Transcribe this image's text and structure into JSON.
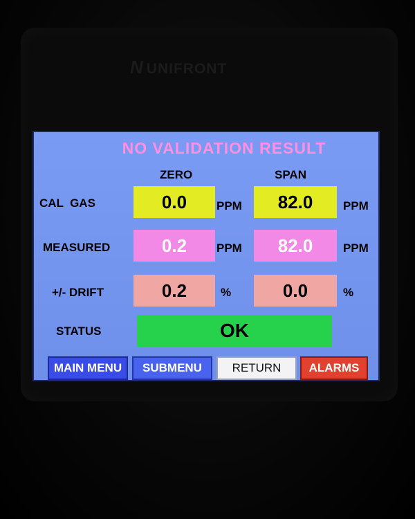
{
  "device": {
    "brand": "UNIFRONT"
  },
  "screen": {
    "title": "NO VALIDATION RESULT",
    "columns": {
      "zero": "ZERO",
      "span": "SPAN"
    },
    "rows": {
      "cal_gas": {
        "label": "CAL  GAS",
        "zero": "0.0",
        "zero_unit": "PPM",
        "span": "82.0",
        "span_unit": "PPM"
      },
      "measured": {
        "label": "MEASURED",
        "zero": "0.2",
        "zero_unit": "PPM",
        "span": "82.0",
        "span_unit": "PPM"
      },
      "drift": {
        "label": "+/- DRIFT",
        "zero": "0.2",
        "zero_unit": "%",
        "span": "0.0",
        "span_unit": "%"
      },
      "status": {
        "label": "STATUS",
        "value": "OK"
      }
    },
    "buttons": {
      "main_menu": "MAIN MENU",
      "submenu": "SUBMENU",
      "return": "RETURN",
      "alarms": "ALARMS"
    },
    "colors": {
      "screen_bg": "#7a9bf3",
      "title": "#ff8fe0",
      "cal_gas_box": "#e3ec22",
      "measured_box": "#f289e6",
      "drift_box": "#f0a7a3",
      "status_box": "#26d24c",
      "alarms_button": "#e0422f"
    }
  }
}
